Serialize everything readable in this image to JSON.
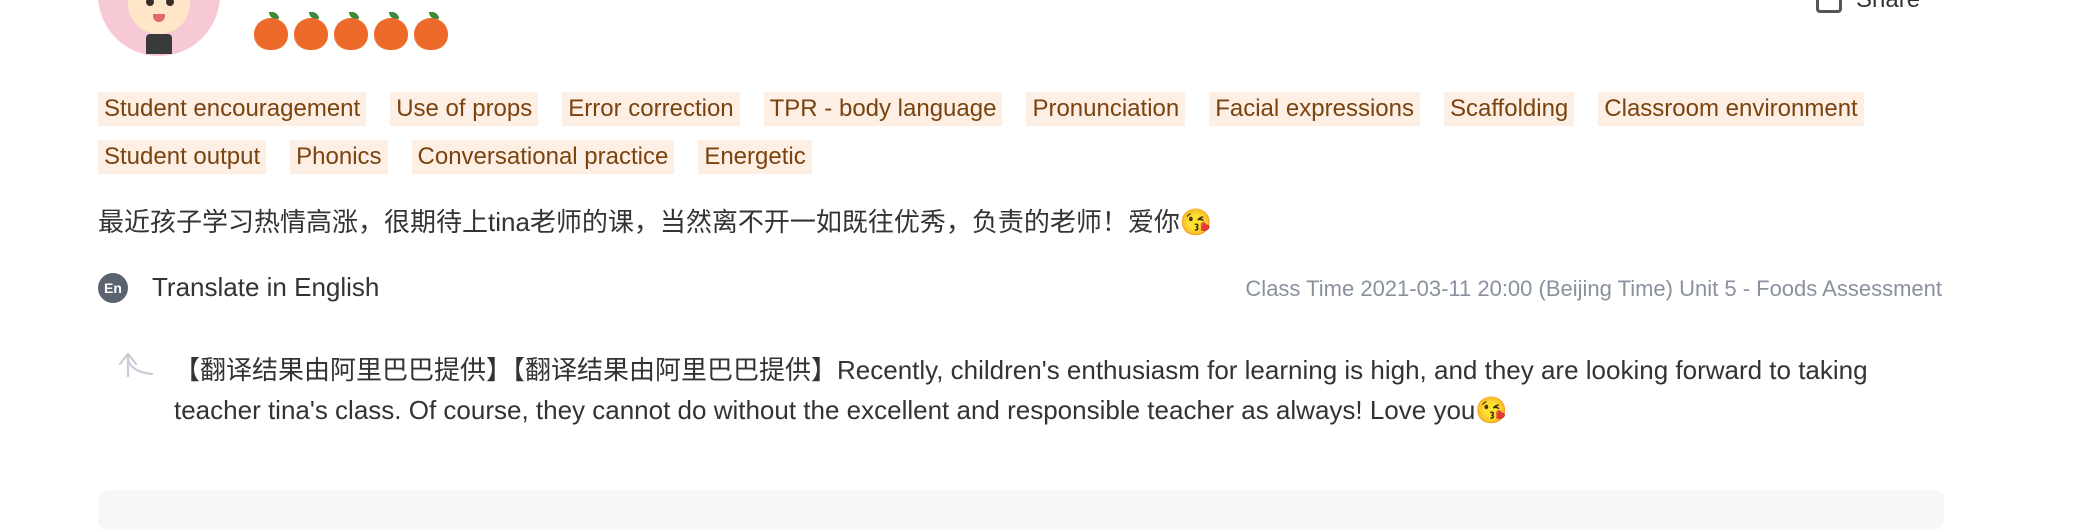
{
  "header": {
    "share_label": "Share"
  },
  "rating": {
    "value": 5,
    "max": 5,
    "icon": "apple-icon",
    "color": "#ee6a2a"
  },
  "tags": [
    "Student encouragement",
    "Use of props",
    "Error correction",
    "TPR - body language",
    "Pronunciation",
    "Facial expressions",
    "Scaffolding",
    "Classroom environment",
    "Student output",
    "Phonics",
    "Conversational practice",
    "Energetic"
  ],
  "review": {
    "text": "最近孩子学习热情高涨，很期待上tina老师的课，当然离不开一如既往优秀，负责的老师！爱你😘"
  },
  "translate": {
    "icon_label": "En",
    "label": "Translate in English",
    "class_time": "Class Time 2021-03-11 20:00 (Beijing Time) Unit 5 - Foods Assessment",
    "result": "【翻译结果由阿里巴巴提供】【翻译结果由阿里巴巴提供】Recently, children's enthusiasm for learning is high, and they are looking forward to taking teacher tina's class. Of course, they cannot do without the excellent and responsible teacher as always! Love you😘"
  },
  "colors": {
    "tag_bg": "#fdefe3",
    "tag_text": "#7a4310",
    "muted": "#8a919e"
  }
}
